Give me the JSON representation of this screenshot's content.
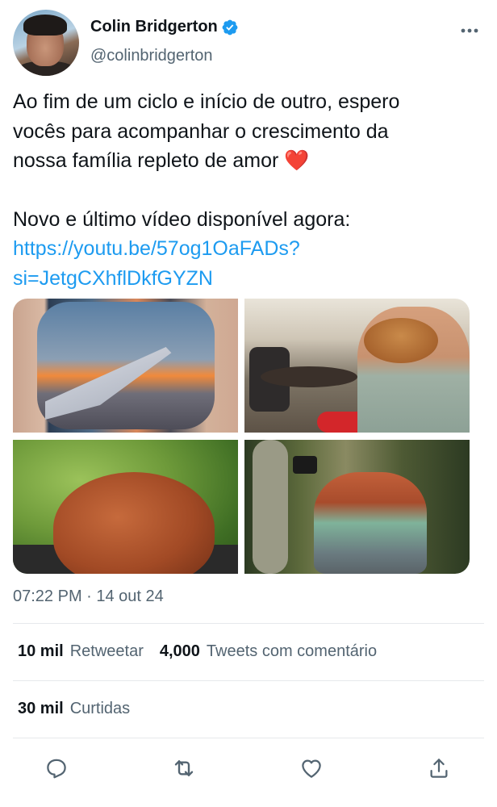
{
  "author": {
    "display_name": "Colin Bridgerton",
    "handle": "@colinbridgerton",
    "avatar_icon": "profile-photo",
    "verified_icon": "verified-badge-icon",
    "verified_color": "#1d9bf0"
  },
  "more_icon": "more-horizontal-icon",
  "tweet": {
    "line1": "Ao fim de um ciclo e início de outro, espero",
    "line2": "vocês para acompanhar o crescimento da",
    "line3": "nossa família repleto de amor ❤️",
    "line4": "Novo e último vídeo disponível agora:",
    "link_line1": "https://youtu.be/57og1OaFADs?",
    "link_line2": "si=JetgCXhflDkfGYZN",
    "link_color": "#1d9bf0"
  },
  "timestamp": "07:22 PM · 14 out 24",
  "stats": {
    "retweets_count": "10 mil",
    "retweets_label": "Retweetar",
    "quotes_count": "4,000",
    "quotes_label": "Tweets com comentário",
    "likes_count": "30 mil",
    "likes_label": "Curtidas"
  },
  "actions": [
    "reply-icon",
    "retweet-icon",
    "like-icon",
    "share-icon"
  ],
  "colors": {
    "text": "#0f1419",
    "secondary": "#536471",
    "divider": "#e6e9ec"
  }
}
